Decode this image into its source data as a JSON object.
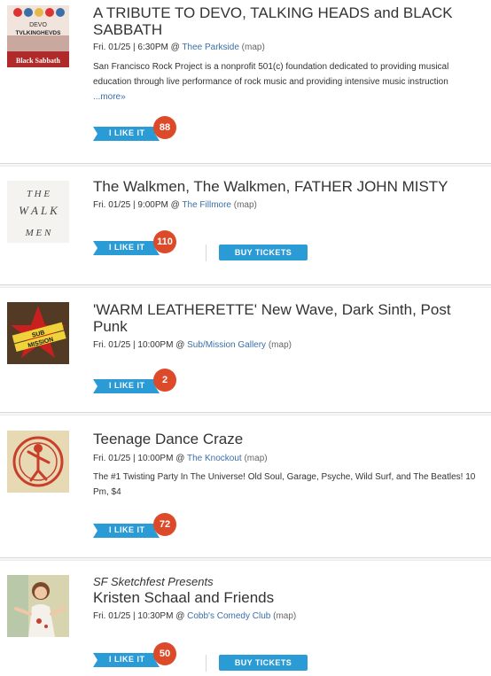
{
  "events": [
    {
      "title": "A TRIBUTE TO DEVO, TALKING HEADS and BLACK SABBATH",
      "date_time": "Fri. 01/25 | 6:30PM @",
      "venue": "Thee Parkside",
      "map_label": "(map)",
      "description": "San Francisco Rock Project is a nonprofit 501(c) foundation dedicated to providing musical education through live performance of rock music and providing intensive music instruction",
      "more_label": "...more»",
      "like_label": "I LIKE IT",
      "like_count": "88",
      "thumb_text": {
        "line1": "DEVO",
        "line2": "TVLKINGHEVDS",
        "line3": "Black Sabbath"
      }
    },
    {
      "title": "The Walkmen, The Walkmen, FATHER JOHN MISTY",
      "date_time": "Fri. 01/25 | 9:00PM @",
      "venue": "The Fillmore",
      "map_label": "(map)",
      "like_label": "I LIKE IT",
      "like_count": "110",
      "buy_label": "BUY TICKETS",
      "thumb_text": {
        "line1": "T H E",
        "line2": "W A L K",
        "line3": "M E N"
      }
    },
    {
      "title": "'WARM LEATHERETTE' New Wave, Dark Sinth, Post Punk",
      "date_time": "Fri. 01/25 | 10:00PM @",
      "venue": "Sub/Mission Gallery",
      "map_label": "(map)",
      "like_label": "I LIKE IT",
      "like_count": "2",
      "thumb_text": {
        "line1": "SUB",
        "line2": "MISSION"
      }
    },
    {
      "title": "Teenage Dance Craze",
      "date_time": "Fri. 01/25 | 10:00PM @",
      "venue": "The Knockout",
      "map_label": "(map)",
      "description": "The #1 Twisting Party In The Universe! Old Soul, Garage, Psyche, Wild Surf, and The Beatles! 10 Pm, $4",
      "like_label": "I LIKE IT",
      "like_count": "72"
    },
    {
      "presenter": "SF Sketchfest Presents",
      "title": "Kristen Schaal and Friends",
      "date_time": "Fri. 01/25 | 10:30PM @",
      "venue": "Cobb's Comedy Club",
      "map_label": "(map)",
      "like_label": "I LIKE IT",
      "like_count": "50",
      "buy_label": "BUY TICKETS"
    }
  ],
  "colors": {
    "like_ribbon": "#2a9bd4",
    "count_badge": "#dc4a29",
    "buy_button": "#2a9bd4",
    "link": "#3a6fa8"
  }
}
